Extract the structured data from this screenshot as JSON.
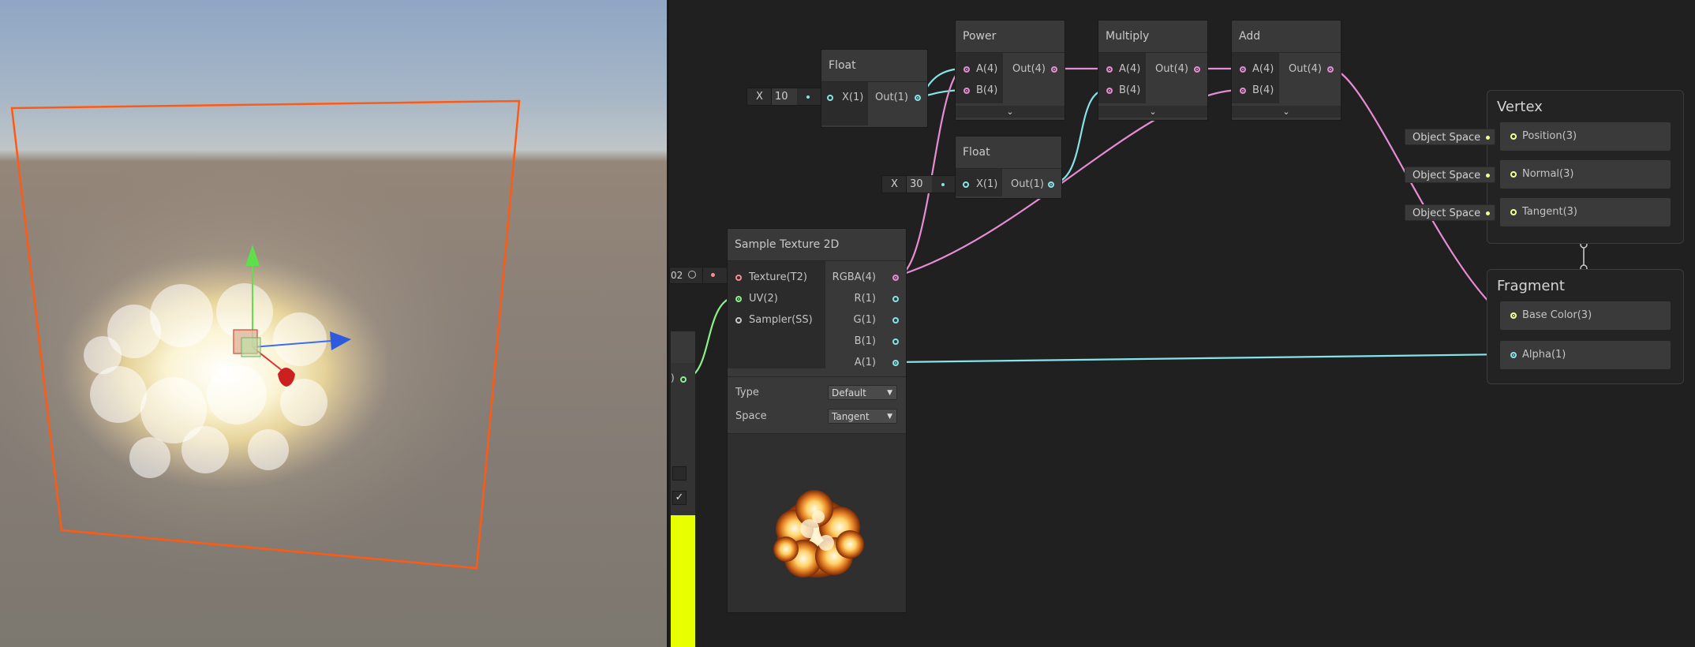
{
  "nodes": {
    "float_a": {
      "title": "Float",
      "field_label": "X",
      "field_value": "10",
      "input": "X(1)",
      "output": "Out(1)"
    },
    "float_b": {
      "title": "Float",
      "field_label": "X",
      "field_value": "30",
      "input": "X(1)",
      "output": "Out(1)"
    },
    "power": {
      "title": "Power",
      "input_a": "A(4)",
      "input_b": "B(4)",
      "output": "Out(4)",
      "chevron": "⌄"
    },
    "multiply": {
      "title": "Multiply",
      "input_a": "A(4)",
      "input_b": "B(4)",
      "output": "Out(4)",
      "chevron": "⌄"
    },
    "add": {
      "title": "Add",
      "input_a": "A(4)",
      "input_b": "B(4)",
      "output": "Out(4)",
      "chevron": "⌄"
    },
    "sample_texture": {
      "title": "Sample Texture 2D",
      "inputs": [
        "Texture(T2)",
        "UV(2)",
        "Sampler(SS)"
      ],
      "outputs": [
        "RGBA(4)",
        "R(1)",
        "G(1)",
        "B(1)",
        "A(1)"
      ],
      "type_label": "Type",
      "type_value": "Default",
      "space_label": "Space",
      "space_value": "Tangent",
      "texture_field_text": "02",
      "uv_field_text": ")"
    }
  },
  "vertex": {
    "title": "Vertex",
    "slots": [
      "Position(3)",
      "Normal(3)",
      "Tangent(3)"
    ],
    "context_labels": [
      "Object Space",
      "Object Space",
      "Object Space"
    ]
  },
  "fragment": {
    "title": "Fragment",
    "slots": [
      "Base Color(3)",
      "Alpha(1)"
    ]
  },
  "colors": {
    "vector4_port": "#e68cd2",
    "float_port": "#84e4e7",
    "vector2_port": "#8af08a",
    "texture_port": "#ff8b8b",
    "sampler_port": "#c8c8c8",
    "vector3_port": "#f6ff9a",
    "scene_gizmo_frame": "#ff5a14",
    "sidebar_yellow": "#e8ff00"
  },
  "icons": [
    "chevron-down-icon",
    "checkmark-icon",
    "target-icon",
    "transform-gizmo-icon"
  ]
}
